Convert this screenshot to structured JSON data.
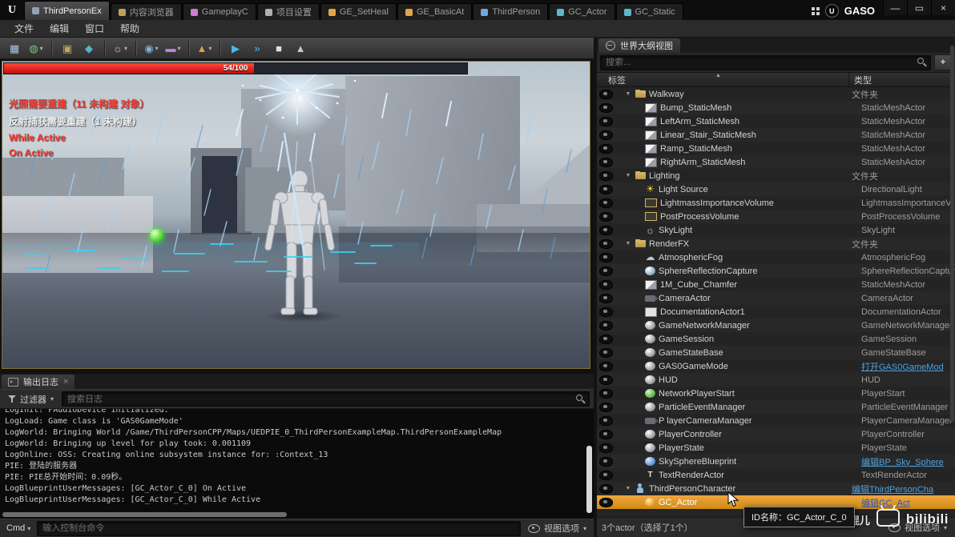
{
  "icons": {
    "ue_logo": "U",
    "caret": "▾",
    "sort": "▲",
    "expand": "▼",
    "close": "×"
  },
  "titlebar": {
    "project": "GASO",
    "tabs": [
      {
        "label": "ThirdPersonEx",
        "active": true,
        "icon_color": "#8fa3b8"
      },
      {
        "label": "内容浏览器",
        "active": false,
        "icon_color": "#c2a05a"
      },
      {
        "label": "GameplayC",
        "active": false,
        "icon_color": "#d07ad0"
      },
      {
        "label": "项目设置",
        "active": false,
        "icon_color": "#b0b0b0"
      },
      {
        "label": "GE_SetHeal",
        "active": false,
        "icon_color": "#e0a44a"
      },
      {
        "label": "GE_BasicAt",
        "active": false,
        "icon_color": "#e0a44a"
      },
      {
        "label": "ThirdPerson",
        "active": false,
        "icon_color": "#6fa8dc"
      },
      {
        "label": "GC_Actor",
        "active": false,
        "icon_color": "#5fb8c9"
      },
      {
        "label": "GC_Static",
        "active": false,
        "icon_color": "#5fb8c9"
      }
    ],
    "window_buttons": [
      {
        "name": "minimize-button",
        "glyph": "—"
      },
      {
        "name": "restore-button",
        "glyph": "▭"
      },
      {
        "name": "close-button",
        "glyph": "×"
      }
    ]
  },
  "menubar": {
    "items": [
      "文件",
      "编辑",
      "窗口",
      "帮助"
    ]
  },
  "toolbar": {
    "buttons": [
      {
        "name": "save",
        "glyph": "▦",
        "tint": "#a9c6e8"
      },
      {
        "name": "source-control",
        "glyph": "◍",
        "tint": "#74c476",
        "caret": true
      },
      {
        "sep": true
      },
      {
        "name": "content",
        "glyph": "▣",
        "tint": "#c9a35a"
      },
      {
        "name": "marketplace",
        "glyph": "◆",
        "tint": "#53b5cf"
      },
      {
        "sep": true
      },
      {
        "name": "settings",
        "glyph": "☼",
        "tint": "#cfcfcf",
        "caret": true
      },
      {
        "sep": true
      },
      {
        "name": "blueprints",
        "glyph": "◉",
        "tint": "#7fb2e0",
        "caret": true
      },
      {
        "name": "cinematics",
        "glyph": "▬",
        "tint": "#b48ad6",
        "caret": true
      },
      {
        "sep": true
      },
      {
        "name": "build",
        "glyph": "▲",
        "tint": "#d6a254",
        "caret": true
      },
      {
        "sep": true
      },
      {
        "name": "play",
        "glyph": "▶",
        "tint": "#49b8f0"
      },
      {
        "name": "frame-skip",
        "glyph": "»",
        "tint": "#49b8f0"
      },
      {
        "name": "stop",
        "glyph": "■",
        "tint": "#e0e0e0"
      },
      {
        "name": "eject",
        "glyph": "▲",
        "tint": "#c8c8c8"
      }
    ]
  },
  "viewport": {
    "health": {
      "current": 54,
      "max": 100,
      "label": "54/100"
    },
    "messages": [
      {
        "text": "光照需要重建（11 未构建 对象）",
        "color": "#ff3b30"
      },
      {
        "text": "反射捕获需要重建（1 未构建）",
        "color": "#efefef"
      },
      {
        "text": "While Active",
        "color": "#ff3b30"
      },
      {
        "text": "On Active",
        "color": "#ff3b30"
      }
    ]
  },
  "output_log": {
    "tab_label": "输出日志",
    "filter_label": "过滤器",
    "search_placeholder": "搜索日志",
    "cmd_label": "Cmd",
    "cmd_placeholder": "输入控制台命令",
    "view_options_label": "视图选项",
    "lines": [
      "LogInit: FAudioDevice initialized.",
      "LogLoad: Game class is 'GAS0GameMode'",
      "LogWorld: Bringing World /Game/ThirdPersonCPP/Maps/UEDPIE_0_ThirdPersonExampleMap.ThirdPersonExampleMap",
      "LogWorld: Bringing up level for play took: 0.001109",
      "LogOnline: OSS: Creating online subsystem instance for: :Context_13",
      "PIE: 登陆的服务器",
      "PIE: PIE总开始时间：0.09秒。",
      "LogBlueprintUserMessages: [GC_Actor_C_0] On Active",
      "LogBlueprintUserMessages: [GC_Actor_C_0] While Active"
    ]
  },
  "outliner": {
    "title": "世界大纲视图",
    "search_placeholder": "搜索...",
    "columns": {
      "label": "标签",
      "type": "类型"
    },
    "status": "3个actor（选择了1个）",
    "view_options_label": "视图选项",
    "rows": [
      {
        "label": "Walkway",
        "type": "文件夹",
        "icon": "folder",
        "indent": 1,
        "expanded": true
      },
      {
        "label": "Bump_StaticMesh",
        "type": "StaticMeshActor",
        "icon": "mesh",
        "indent": 2
      },
      {
        "label": "LeftArm_StaticMesh",
        "type": "StaticMeshActor",
        "icon": "mesh",
        "indent": 2
      },
      {
        "label": "Linear_Stair_StaticMesh",
        "type": "StaticMeshActor",
        "icon": "mesh",
        "indent": 2
      },
      {
        "label": "Ramp_StaticMesh",
        "type": "StaticMeshActor",
        "icon": "mesh",
        "indent": 2
      },
      {
        "label": "RightArm_StaticMesh",
        "type": "StaticMeshActor",
        "icon": "mesh",
        "indent": 2
      },
      {
        "label": "Lighting",
        "type": "文件夹",
        "icon": "folder",
        "indent": 1,
        "expanded": true
      },
      {
        "label": "Light Source",
        "type": "DirectionalLight",
        "icon": "sun",
        "indent": 2
      },
      {
        "label": "LightmassImportanceVolume",
        "type": "LightmassImportanceV",
        "icon": "volume",
        "indent": 2
      },
      {
        "label": "PostProcessVolume",
        "type": "PostProcessVolume",
        "icon": "volume",
        "indent": 2
      },
      {
        "label": "SkyLight",
        "type": "SkyLight",
        "icon": "skylight",
        "indent": 2
      },
      {
        "label": "RenderFX",
        "type": "文件夹",
        "icon": "folder",
        "indent": 1,
        "expanded": true
      },
      {
        "label": "AtmosphericFog",
        "type": "AtmosphericFog",
        "icon": "fog",
        "indent": 2
      },
      {
        "label": "SphereReflectionCapture",
        "type": "SphereReflectionCaptur",
        "icon": "capture",
        "indent": 2
      },
      {
        "label": "1M_Cube_Chamfer",
        "type": "StaticMeshActor",
        "icon": "mesh",
        "indent": 2
      },
      {
        "label": "CameraActor",
        "type": "CameraActor",
        "icon": "camera",
        "indent": 2
      },
      {
        "label": "DocumentationActor1",
        "type": "DocumentationActor",
        "icon": "doc",
        "indent": 2
      },
      {
        "label": "GameNetworkManager",
        "type": "GameNetworkManager",
        "icon": "orb",
        "indent": 2
      },
      {
        "label": "GameSession",
        "type": "GameSession",
        "icon": "orb",
        "indent": 2
      },
      {
        "label": "GameStateBase",
        "type": "GameStateBase",
        "icon": "orb",
        "indent": 2
      },
      {
        "label": "GAS0GameMode",
        "type": "打开GAS0GameMod",
        "icon": "orb",
        "indent": 2,
        "link": true
      },
      {
        "label": "HUD",
        "type": "HUD",
        "icon": "orb",
        "indent": 2
      },
      {
        "label": "NetworkPlayerStart",
        "type": "PlayerStart",
        "icon": "orb-green",
        "indent": 2
      },
      {
        "label": "ParticleEventManager",
        "type": "ParticleEventManager",
        "icon": "orb",
        "indent": 2
      },
      {
        "label": "P layerCameraManager",
        "type": "PlayerCameraManager",
        "icon": "camera",
        "indent": 2
      },
      {
        "label": "PlayerController",
        "type": "PlayerController",
        "icon": "orb",
        "indent": 2
      },
      {
        "label": "PlayerState",
        "type": "PlayerState",
        "icon": "orb",
        "indent": 2
      },
      {
        "label": "SkySphereBlueprint",
        "type": "编辑BP_Sky_Sphere",
        "icon": "orb-blue",
        "indent": 2,
        "link": true
      },
      {
        "label": "TextRenderActor",
        "type": "TextRenderActor",
        "icon": "text",
        "indent": 2
      },
      {
        "label": "ThirdPersonCharacter",
        "type": "编辑ThirdPersonCha",
        "icon": "char",
        "indent": 1,
        "expanded": true,
        "link": true
      },
      {
        "label": "GC_Actor",
        "type": "编辑GC_Act",
        "icon": "gc",
        "indent": 2,
        "link": true,
        "selected": true
      }
    ]
  },
  "tooltip": {
    "text": "ID名称：GC_Actor_C_0"
  },
  "watermark": {
    "name": "技术宅阿棍儿",
    "brand": "bilibili"
  }
}
